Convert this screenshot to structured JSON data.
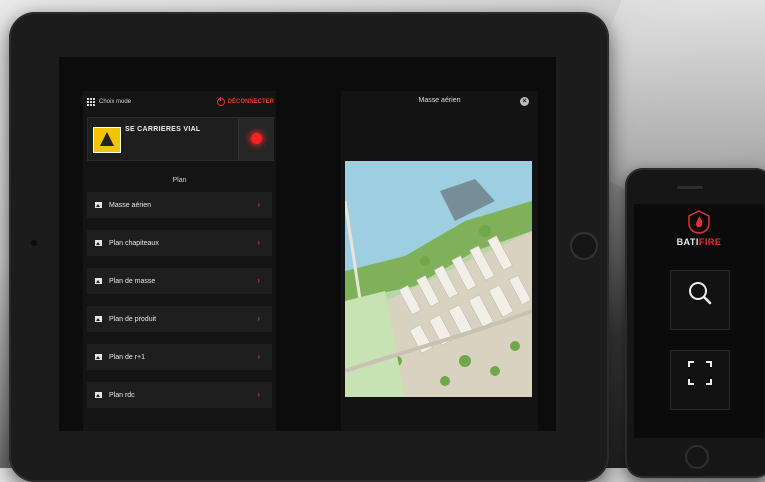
{
  "left_panel": {
    "mode_label": "Choix mode",
    "logout_label": "DÉCONNECTER",
    "company": {
      "name": "SE CARRIERES VIAL",
      "address": "",
      "phone": ""
    },
    "section_title": "Plan",
    "items": [
      {
        "label": "Masse aérien"
      },
      {
        "label": "Plan chapiteaux"
      },
      {
        "label": "Plan de masse"
      },
      {
        "label": "Plan de produit"
      },
      {
        "label": "Plan de r+1"
      },
      {
        "label": "Plan rdc"
      }
    ]
  },
  "right_panel": {
    "title": "Masse aérien",
    "close_symbol": "×"
  },
  "phone": {
    "brand_part1": "BATI",
    "brand_part2": "FIRE",
    "tagline": "",
    "search_caption": "",
    "or_label": "",
    "scan_caption": "",
    "logout_label": ""
  },
  "colors": {
    "accent": "#e23030",
    "panel": "#1e1e1e",
    "background": "#0c0c0c"
  },
  "icons": {
    "mode": "grid-icon",
    "logout": "power-icon",
    "item": "image-icon",
    "chevron": "chevron-right-icon",
    "close": "close-icon",
    "search": "search-icon",
    "scan": "scan-icon"
  }
}
